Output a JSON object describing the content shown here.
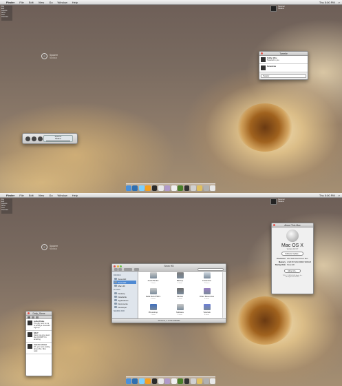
{
  "menubar": {
    "app": "Finder",
    "items": [
      "File",
      "Edit",
      "View",
      "Go",
      "Window",
      "Help"
    ],
    "clock": "Thu 5:00 PM"
  },
  "topleft_lines": [
    "File",
    "Edit",
    "Aspects",
    "Sizes",
    "Grid",
    "Overview"
  ],
  "spooner": {
    "title": "Spooner",
    "subtitle": "Nadaus"
  },
  "tweetie": {
    "title": "Tweetie",
    "lines": [
      "Oddly, Mine",
      "Tweeted to you",
      "Fenestrate"
    ],
    "input": "Tweeter"
  },
  "player": {
    "title": "Spooner",
    "subtitle": "Nadaus",
    "time": "1:10"
  },
  "about": {
    "title": "About This Mac",
    "os": "Mac OS X",
    "version": "Version 10.5.7",
    "update_button": "Software Update...",
    "specs": [
      {
        "k": "Processor",
        "v": "2.16 GHz Intel Core 2 Duo"
      },
      {
        "k": "Memory",
        "v": "2 GB 667 MHz DDR2 SDRAM"
      },
      {
        "k": "Startup Disk",
        "v": "Snow HD"
      }
    ],
    "more_button": "More Info...",
    "footer": [
      "TM & © 1983-2009 Apple Inc.",
      "All Rights Reserved."
    ]
  },
  "finder": {
    "title": "Snow HD",
    "sidebar": [
      {
        "header": "DEVICES",
        "items": [
          "Snow HD",
          "Snow HD",
          "Mac HD"
        ]
      },
      {
        "header": "PLACES",
        "items": [
          "Desktop",
          "Dateifehle",
          "Applications",
          "Documents",
          "Developer"
        ]
      },
      {
        "header": "SEARCH FOR",
        "items": []
      }
    ],
    "items": [
      {
        "name": "Audio Books",
        "sub": "7 items",
        "color": "#c9c9c9"
      },
      {
        "name": "Backup",
        "sub": "3 items",
        "color": "#7b7b7b"
      },
      {
        "name": "Customize",
        "sub": "11 items",
        "color": "#cfd8e0"
      },
      {
        "name": "Delta New PSD's",
        "sub": "5 items",
        "color": "#c9c9c9"
      },
      {
        "name": "Movies",
        "sub": "2 items",
        "color": "#6e6e6e"
      },
      {
        "name": "Other Resources",
        "sub": "3 items",
        "color": "#9a7fc2"
      },
      {
        "name": "Photoshop",
        "sub": "7 items",
        "color": "#3f6fbf"
      },
      {
        "name": "Software",
        "sub": "9 items",
        "color": "#c9c9c9"
      },
      {
        "name": "Tutorials",
        "sub": "8 items",
        "color": "#6c7fd6"
      }
    ],
    "status": "10 items, 1.2 TB available"
  },
  "twitter": {
    "title": "Daily_Steve",
    "tweets": [
      {
        "name": "ashleyDrake",
        "text": "The guy next to me is writing a shameful sign-up"
      },
      {
        "name": "NKLT",
        "text": "Have you guys seen the ICONIX? It's amazing"
      },
      {
        "name": "Jake Brockman",
        "text": "Oh, you were asking about this. Nice work"
      }
    ]
  },
  "dock": {
    "colors": [
      "#4a90d9",
      "#2f6fb0",
      "#7bd0ff",
      "#f5a020",
      "#2b2b2b",
      "#e8e8e8",
      "#b09aca",
      "#f0f0f0",
      "#4a7f2a",
      "#333333",
      "#d0d0d0",
      "#e0c060",
      "#b0b0b0",
      "#e8e8e8"
    ]
  }
}
